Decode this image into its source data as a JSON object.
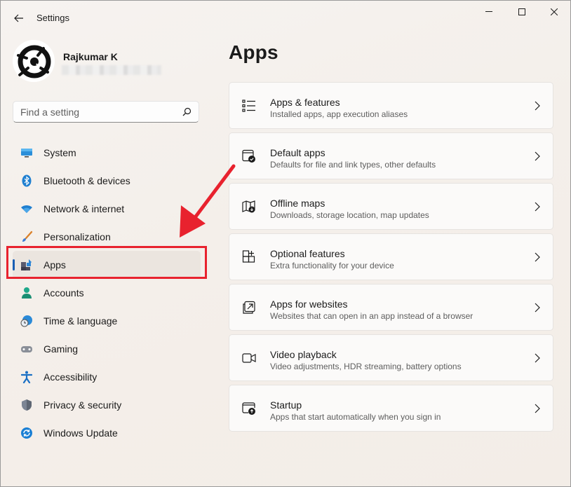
{
  "window": {
    "title": "Settings"
  },
  "profile": {
    "name": "Rajkumar K"
  },
  "search": {
    "placeholder": "Find a setting"
  },
  "nav": {
    "items": [
      {
        "label": "System",
        "icon": "monitor-icon"
      },
      {
        "label": "Bluetooth & devices",
        "icon": "bluetooth-icon"
      },
      {
        "label": "Network & internet",
        "icon": "wifi-icon"
      },
      {
        "label": "Personalization",
        "icon": "brush-icon"
      },
      {
        "label": "Apps",
        "icon": "apps-icon",
        "selected": true
      },
      {
        "label": "Accounts",
        "icon": "person-icon"
      },
      {
        "label": "Time & language",
        "icon": "clock-globe-icon"
      },
      {
        "label": "Gaming",
        "icon": "gamepad-icon"
      },
      {
        "label": "Accessibility",
        "icon": "accessibility-icon"
      },
      {
        "label": "Privacy & security",
        "icon": "shield-icon"
      },
      {
        "label": "Windows Update",
        "icon": "update-icon"
      }
    ]
  },
  "page": {
    "title": "Apps"
  },
  "cards": [
    {
      "title": "Apps & features",
      "desc": "Installed apps, app execution aliases",
      "icon": "list-icon"
    },
    {
      "title": "Default apps",
      "desc": "Defaults for file and link types, other defaults",
      "icon": "default-apps-icon"
    },
    {
      "title": "Offline maps",
      "desc": "Downloads, storage location, map updates",
      "icon": "map-icon"
    },
    {
      "title": "Optional features",
      "desc": "Extra functionality for your device",
      "icon": "optional-features-icon"
    },
    {
      "title": "Apps for websites",
      "desc": "Websites that can open in an app instead of a browser",
      "icon": "open-in-app-icon"
    },
    {
      "title": "Video playback",
      "desc": "Video adjustments, HDR streaming, battery options",
      "icon": "video-camera-icon"
    },
    {
      "title": "Startup",
      "desc": "Apps that start automatically when you sign in",
      "icon": "startup-icon"
    }
  ],
  "colors": {
    "accent": "#1a5fb4",
    "annotation": "#e8222e"
  }
}
